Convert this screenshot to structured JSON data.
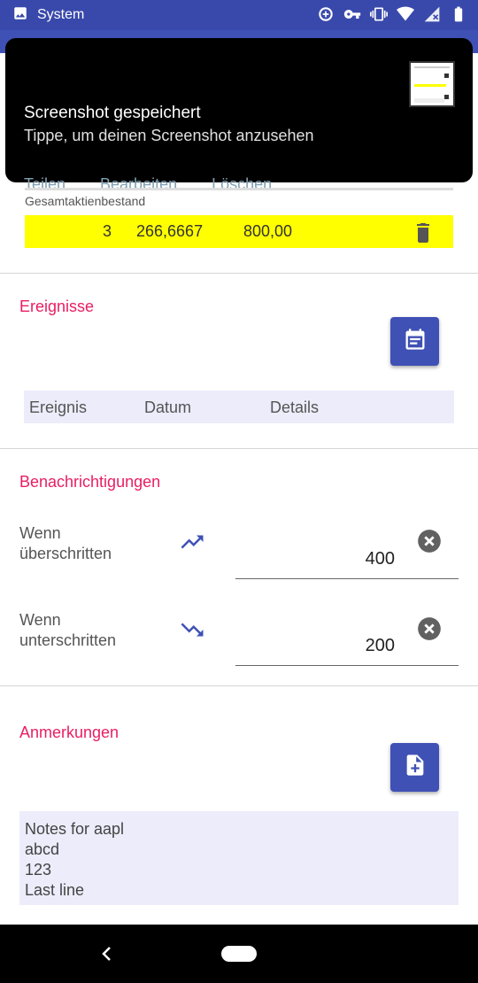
{
  "status_bar": {
    "app_label": "System",
    "icons": [
      "image-icon",
      "data-saver-icon",
      "vpn-key-icon",
      "vibrate-icon",
      "wifi-icon",
      "no-signal-icon",
      "battery-icon"
    ]
  },
  "notification": {
    "title": "Screenshot gespeichert",
    "text": "Tippe, um deinen Screenshot anzusehen",
    "actions": [
      "Teilen",
      "Bearbeiten",
      "Löschen"
    ]
  },
  "total": {
    "label": "Gesamtaktienbestand",
    "quantity": "3",
    "price": "266,6667",
    "value": "800,00",
    "highlight_color": "#ffff00"
  },
  "events": {
    "title": "Ereignisse",
    "columns": [
      "Ereignis",
      "Datum",
      "Details"
    ],
    "add_icon": "calendar-icon"
  },
  "alerts": {
    "title": "Benachrichtigungen",
    "above": {
      "label_line1": "Wenn",
      "label_line2": "überschritten",
      "value": "400",
      "icon": "trending-up-icon"
    },
    "below": {
      "label_line1": "Wenn",
      "label_line2": "unterschritten",
      "value": "200",
      "icon": "trending-down-icon"
    }
  },
  "notes": {
    "title": "Anmerkungen",
    "lines": [
      "Notes for aapl",
      "abcd",
      "123",
      "Last line"
    ],
    "add_icon": "note-add-icon"
  },
  "colors": {
    "primary": "#3f51b5",
    "accent": "#e91e63",
    "status_bar": "#3949ab"
  }
}
